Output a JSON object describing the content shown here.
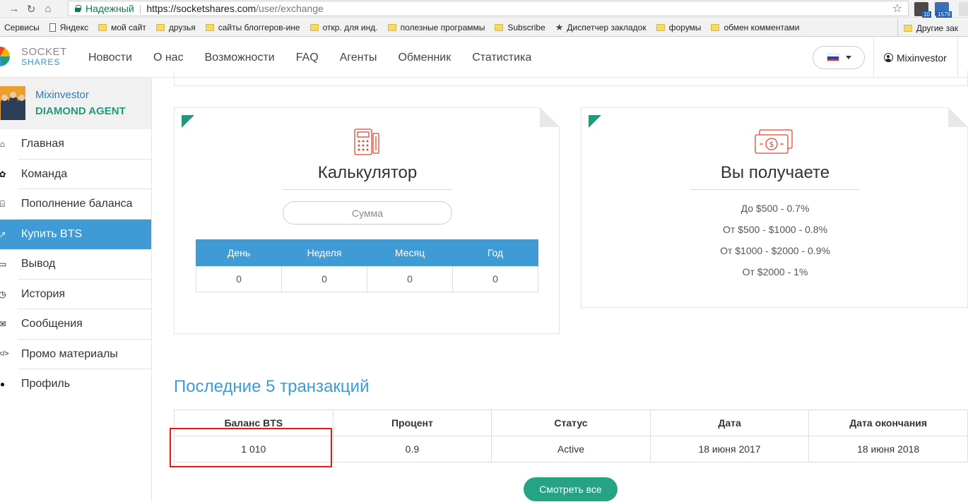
{
  "browser": {
    "secure_label": "Надежный",
    "url_host": "https://socketshares.com",
    "url_path": "/user/exchange",
    "ext_badge_1": "10",
    "ext_badge_2": "1579"
  },
  "bookmarks": {
    "items": [
      "Сервисы",
      "Яндекс",
      "мой сайт",
      "друзья",
      "сайты блоггеров-ине",
      "откр. для инд.",
      "полезные программы",
      "Subscribe",
      "Диспетчер закладок",
      "форумы",
      "обмен комментами"
    ],
    "other": "Другие зак"
  },
  "header": {
    "logo_top": "SOCKET",
    "logo_bottom": "SHARES",
    "nav": [
      "Новости",
      "О нас",
      "Возможности",
      "FAQ",
      "Агенты",
      "Обменник",
      "Статистика"
    ],
    "user": "Mixinvestor"
  },
  "sidebar": {
    "name": "Mixinvestor",
    "rank": "DIAMOND AGENT",
    "items": [
      {
        "label": "Главная",
        "icon": "home-icon",
        "glyph": "⌂"
      },
      {
        "label": "Команда",
        "icon": "paw-icon",
        "glyph": "✿"
      },
      {
        "label": "Пополнение баланса",
        "icon": "bank-icon",
        "glyph": "⌸"
      },
      {
        "label": "Купить BTS",
        "icon": "chart-icon",
        "glyph": "↗"
      },
      {
        "label": "Вывод",
        "icon": "card-icon",
        "glyph": "▭"
      },
      {
        "label": "История",
        "icon": "clock-icon",
        "glyph": "◷"
      },
      {
        "label": "Сообщения",
        "icon": "envelope-icon",
        "glyph": "✉"
      },
      {
        "label": "Промо материалы",
        "icon": "code-icon",
        "glyph": "</>"
      },
      {
        "label": "Профиль",
        "icon": "user-icon",
        "glyph": "●"
      }
    ]
  },
  "calculator": {
    "title": "Калькулятор",
    "placeholder": "Сумма",
    "headers": [
      "День",
      "Неделя",
      "Месяц",
      "Год"
    ],
    "values": [
      "0",
      "0",
      "0",
      "0"
    ]
  },
  "receive": {
    "title": "Вы получаете",
    "rates": [
      "До $500 - 0.7%",
      "От $500 - $1000 - 0.8%",
      "От $1000 - $2000 - 0.9%",
      "От $2000 - 1%"
    ]
  },
  "transactions": {
    "title": "Последние 5 транзакций",
    "headers": [
      "Баланс BTS",
      "Процент",
      "Статус",
      "Дата",
      "Дата окончания"
    ],
    "rows": [
      [
        "1 010",
        "0.9",
        "Active",
        "18 июня 2017",
        "18 июня 2018"
      ]
    ],
    "button": "Смотреть все"
  },
  "colors": {
    "accent": "#3f9bd6",
    "green": "#26a383",
    "highlight": "#e01b1b"
  }
}
